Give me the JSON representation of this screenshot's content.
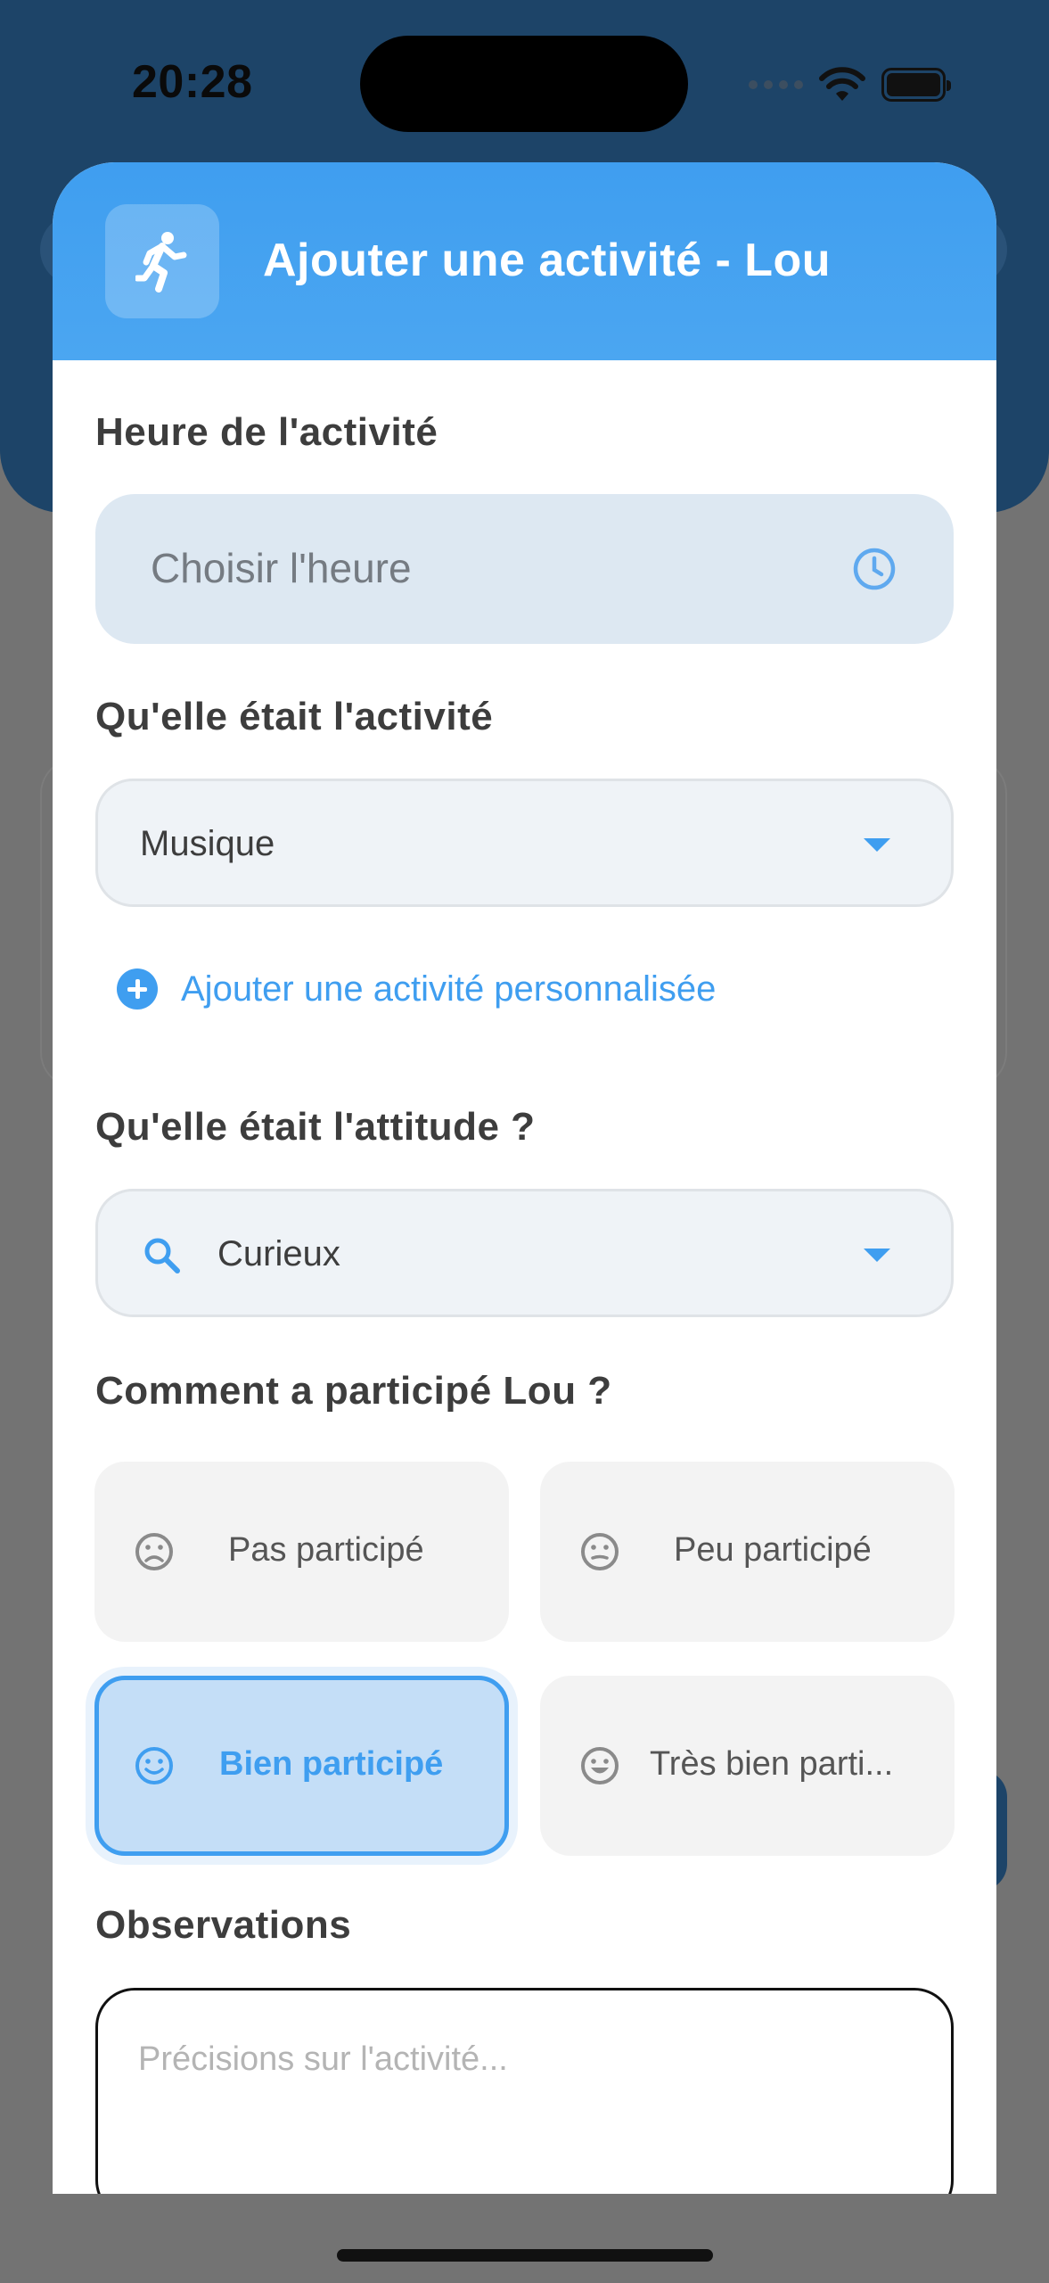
{
  "status_bar": {
    "time": "20:28"
  },
  "modal": {
    "title": "Ajouter une activité - Lou",
    "time_section": {
      "label": "Heure de l'activité",
      "placeholder": "Choisir l'heure"
    },
    "activity_section": {
      "label": "Qu'elle était l'activité",
      "selected": "Musique"
    },
    "add_custom_label": "Ajouter une activité personnalisée",
    "attitude_section": {
      "label": "Qu'elle était l'attitude ?",
      "selected": "Curieux"
    },
    "participation_section": {
      "label": "Comment a participé Lou ?",
      "options": [
        {
          "label": "Pas participé",
          "icon": "sad-face-icon",
          "selected": false
        },
        {
          "label": "Peu participé",
          "icon": "neutral-face-icon",
          "selected": false
        },
        {
          "label": "Bien participé",
          "icon": "smile-face-icon",
          "selected": true
        },
        {
          "label": "Très bien parti...",
          "icon": "grin-face-icon",
          "selected": false
        }
      ]
    },
    "observations_section": {
      "label": "Observations",
      "placeholder": "Précisions sur l'activité..."
    }
  },
  "colors": {
    "accent": "#3f9ef0",
    "header_dark": "#1d4468",
    "overlay": "#737373"
  }
}
